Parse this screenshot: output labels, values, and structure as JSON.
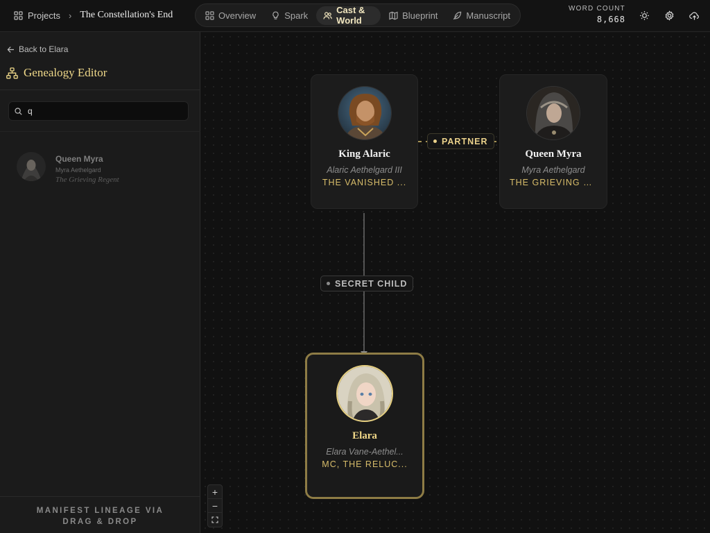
{
  "header": {
    "projects_label": "Projects",
    "story_title": "The Constellation's End",
    "tabs": [
      {
        "label": "Overview",
        "icon": "grid-icon"
      },
      {
        "label": "Spark",
        "icon": "lightbulb-icon"
      },
      {
        "label": "Cast & World",
        "icon": "users-icon",
        "active": true
      },
      {
        "label": "Blueprint",
        "icon": "map-icon"
      },
      {
        "label": "Manuscript",
        "icon": "feather-icon"
      }
    ],
    "word_count_label": "WORD COUNT",
    "word_count_value": "8,668"
  },
  "sidebar": {
    "back_label": "Back to Elara",
    "title": "Genealogy Editor",
    "search_value": "q",
    "results": [
      {
        "name": "Queen Myra",
        "full_name": "Myra Aethelgard",
        "title": "The Grieving Regent"
      }
    ],
    "footer_hint": "MANIFEST LINEAGE VIA DRAG & DROP"
  },
  "canvas": {
    "nodes": {
      "alaric": {
        "name": "King Alaric",
        "full_name": "Alaric Aethelgard III",
        "title": "THE VANISHED ..."
      },
      "myra": {
        "name": "Queen Myra",
        "full_name": "Myra Aethelgard",
        "title": "THE GRIEVING R..."
      },
      "elara": {
        "name": "Elara",
        "full_name": "Elara Vane-Aethel...",
        "title": "MC, THE RELUC..."
      }
    },
    "edges": {
      "partner": "PARTNER",
      "secret_child": "SECRET CHILD"
    },
    "zoom_controls": {
      "in": "+",
      "out": "−",
      "fit": "fit-screen-icon"
    }
  },
  "colors": {
    "accent_gold": "#f0d98a",
    "background": "#111111",
    "panel": "#1b1b1b"
  }
}
